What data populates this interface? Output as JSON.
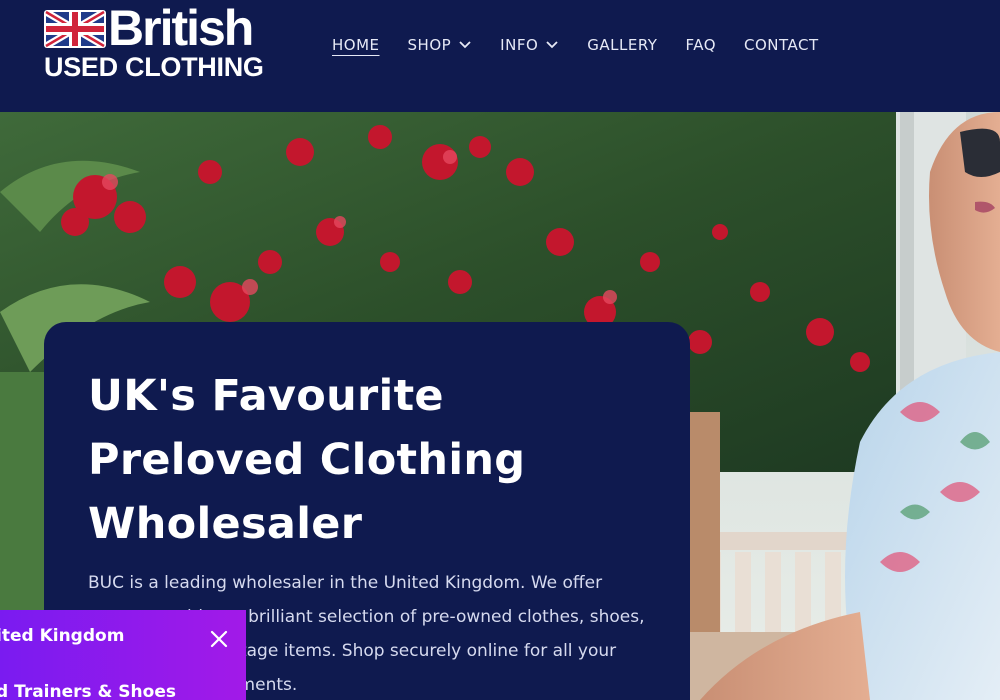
{
  "brand": {
    "name": "British",
    "subname": "USED CLOTHING"
  },
  "nav": {
    "items": [
      {
        "label": "HOME",
        "active": true,
        "has_dropdown": false
      },
      {
        "label": "SHOP",
        "active": false,
        "has_dropdown": true
      },
      {
        "label": "INFO",
        "active": false,
        "has_dropdown": true
      },
      {
        "label": "GALLERY",
        "active": false,
        "has_dropdown": false
      },
      {
        "label": "FAQ",
        "active": false,
        "has_dropdown": false
      },
      {
        "label": "CONTACT",
        "active": false,
        "has_dropdown": false
      }
    ]
  },
  "hero": {
    "title": "UK's Favourite Preloved Clothing Wholesaler",
    "description": "BUC is a leading wholesaler in the United Kingdom. We offer everyone with our brilliant selection of pre-owned clothes, shoes, handbags and vintage items. Shop securely online for all your wholesale requirements."
  },
  "popup": {
    "line1": "ited Kingdom",
    "line2": "d Trainers & Shoes"
  },
  "colors": {
    "navy": "#0f1a4f",
    "popup_purple": "#8f1bee",
    "nav_text": "#e6e9f6"
  },
  "icons": {
    "logo_flag": "union-jack-icon",
    "dropdown": "chevron-down-icon",
    "close": "close-icon"
  }
}
